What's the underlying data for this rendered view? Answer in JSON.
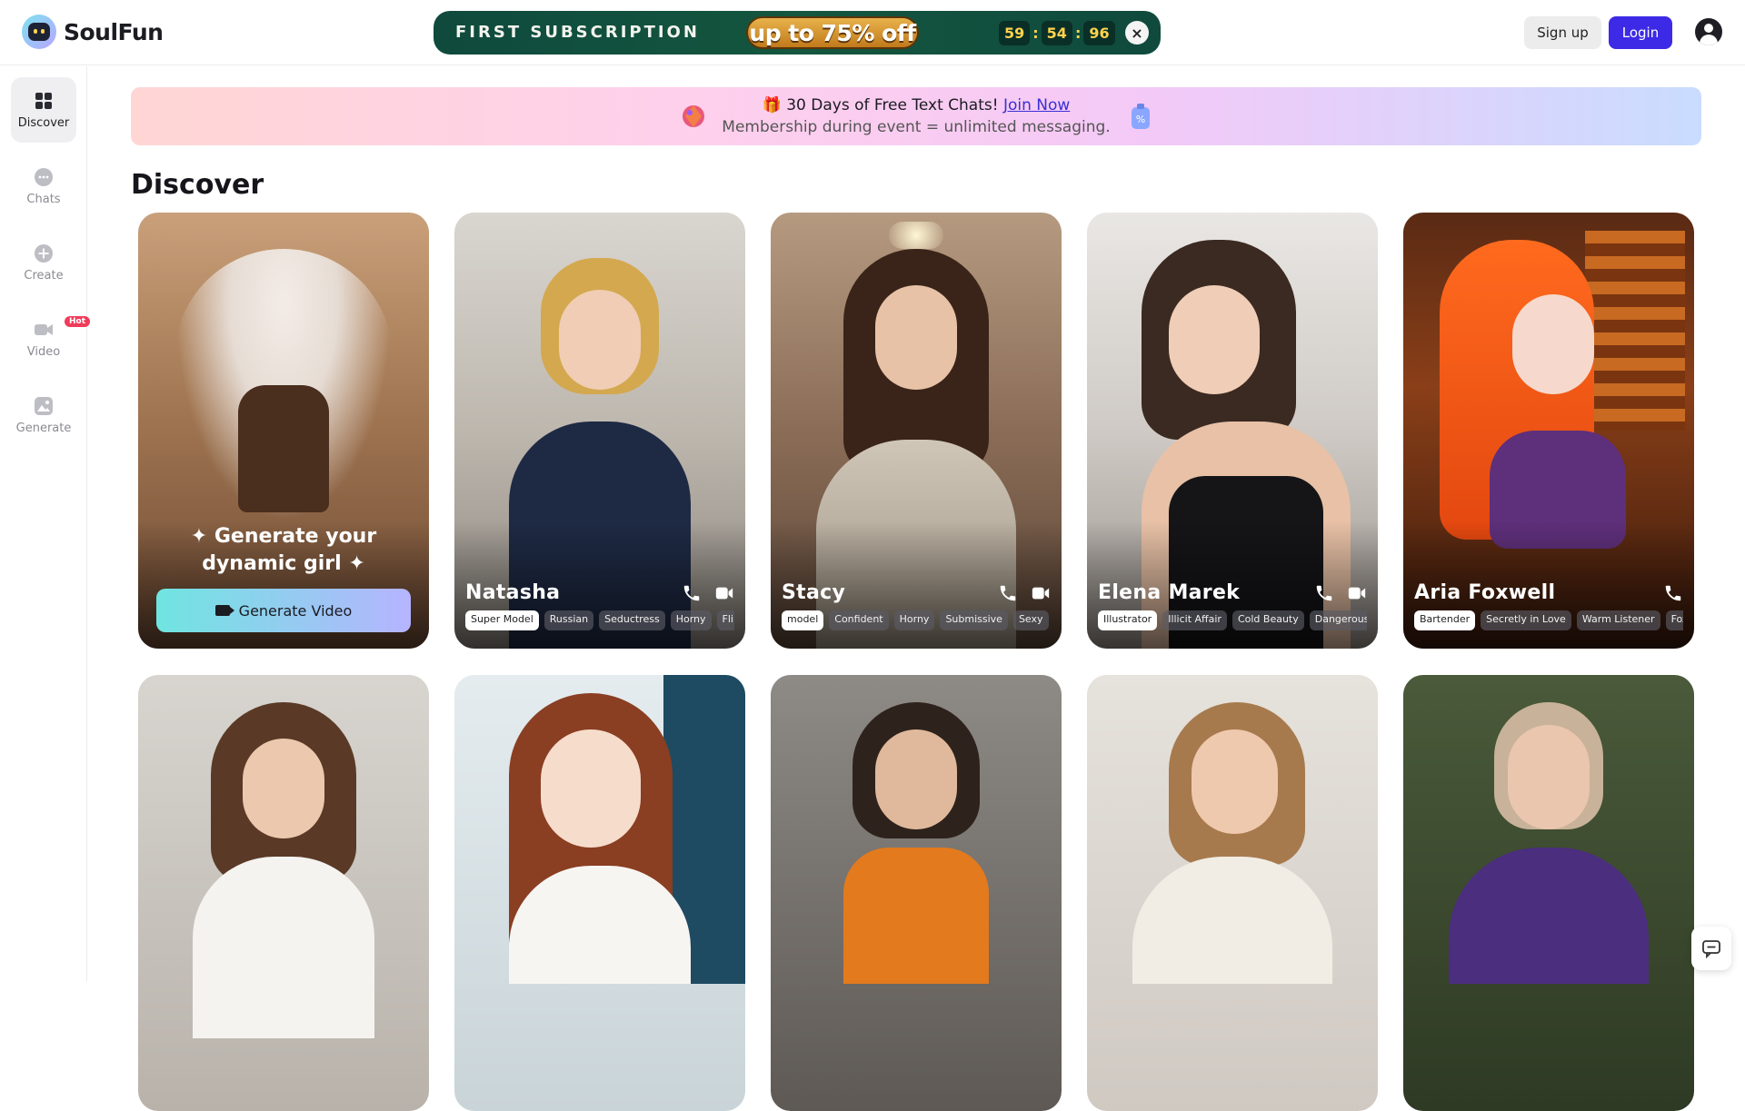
{
  "app": {
    "name": "SoulFun"
  },
  "promo": {
    "title": "FIRST SUBSCRIPTION",
    "discount": "up to 75% off",
    "timer": [
      "59",
      "54",
      "96"
    ],
    "close_label": "×"
  },
  "header": {
    "signup_label": "Sign up",
    "login_label": "Login"
  },
  "sidebar": {
    "items": [
      {
        "label": "Discover",
        "icon": "grid-icon",
        "active": true
      },
      {
        "label": "Chats",
        "icon": "chat-bubble-icon"
      },
      {
        "label": "Create",
        "icon": "plus-circle-icon"
      },
      {
        "label": "Video",
        "icon": "video-camera-icon",
        "badge": "Hot"
      },
      {
        "label": "Generate",
        "icon": "image-icon"
      }
    ]
  },
  "banner": {
    "line1_prefix": "🎁 30 Days of Free Text Chats! ",
    "line1_link": "Join Now",
    "line2": "Membership during event = unlimited messaging."
  },
  "page_title": "Discover",
  "generate_card": {
    "line1": "✦ Generate your",
    "line2": "dynamic girl ✦",
    "button_label": "Generate Video"
  },
  "characters": [
    {
      "name": "Natasha",
      "tags": [
        "Super Model",
        "Russian",
        "Seductress",
        "Horny",
        "Flirt"
      ],
      "video": true
    },
    {
      "name": "Stacy",
      "tags": [
        "model",
        "Confident",
        "Horny",
        "Submissive",
        "Sexy"
      ],
      "video": true
    },
    {
      "name": "Elena Marek",
      "tags": [
        "Illustrator",
        "Illicit Affair",
        "Cold Beauty",
        "Dangerous"
      ],
      "video": true
    },
    {
      "name": "Aria Foxwell",
      "tags": [
        "Bartender",
        "Secretly in Love",
        "Warm Listener",
        "Fox"
      ],
      "video": false
    }
  ],
  "colors": {
    "accent": "#3d2ae6",
    "promo_bg": "#14563f",
    "hot_badge": "#ef3c5a"
  }
}
